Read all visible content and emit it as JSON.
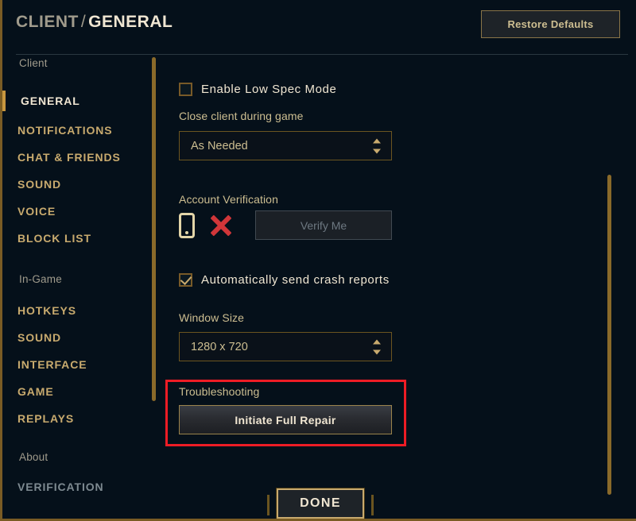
{
  "header": {
    "breadcrumb_parent": "CLIENT",
    "breadcrumb_separator": "/",
    "breadcrumb_current": "GENERAL",
    "restore_defaults_label": "Restore Defaults"
  },
  "sidebar": {
    "groups": [
      {
        "section_label": "Client",
        "items": [
          {
            "label": "GENERAL",
            "state": "active"
          },
          {
            "label": "NOTIFICATIONS",
            "state": "normal"
          },
          {
            "label": "CHAT & FRIENDS",
            "state": "normal"
          },
          {
            "label": "SOUND",
            "state": "normal"
          },
          {
            "label": "VOICE",
            "state": "normal"
          },
          {
            "label": "BLOCK LIST",
            "state": "normal"
          }
        ]
      },
      {
        "section_label": "In-Game",
        "items": [
          {
            "label": "HOTKEYS",
            "state": "normal"
          },
          {
            "label": "SOUND",
            "state": "normal"
          },
          {
            "label": "INTERFACE",
            "state": "normal"
          },
          {
            "label": "GAME",
            "state": "normal"
          },
          {
            "label": "REPLAYS",
            "state": "normal"
          }
        ]
      },
      {
        "section_label": "About",
        "items": [
          {
            "label": "VERIFICATION",
            "state": "muted"
          }
        ]
      }
    ]
  },
  "main": {
    "low_spec": {
      "label": "Enable Low Spec Mode",
      "checked": false
    },
    "close_client": {
      "label": "Close client during game",
      "value": "As Needed"
    },
    "account_verification": {
      "label": "Account Verification",
      "phone_icon": "mobile-phone-icon",
      "status_icon": "red-x-icon",
      "verify_button_label": "Verify Me",
      "verify_button_enabled": false
    },
    "crash_reports": {
      "label": "Automatically send crash reports",
      "checked": true
    },
    "window_size": {
      "label": "Window Size",
      "value": "1280 x 720"
    },
    "troubleshooting": {
      "label": "Troubleshooting",
      "repair_button_label": "Initiate Full Repair"
    }
  },
  "footer": {
    "done_label": "DONE"
  },
  "colors": {
    "background": "#05101a",
    "gold": "#c8aa6e",
    "gold_dark": "#785a28",
    "text_light": "#f0e6d2",
    "text_muted": "#a09b8c",
    "accent_red": "#ee1c25",
    "status_red": "#d13639"
  }
}
